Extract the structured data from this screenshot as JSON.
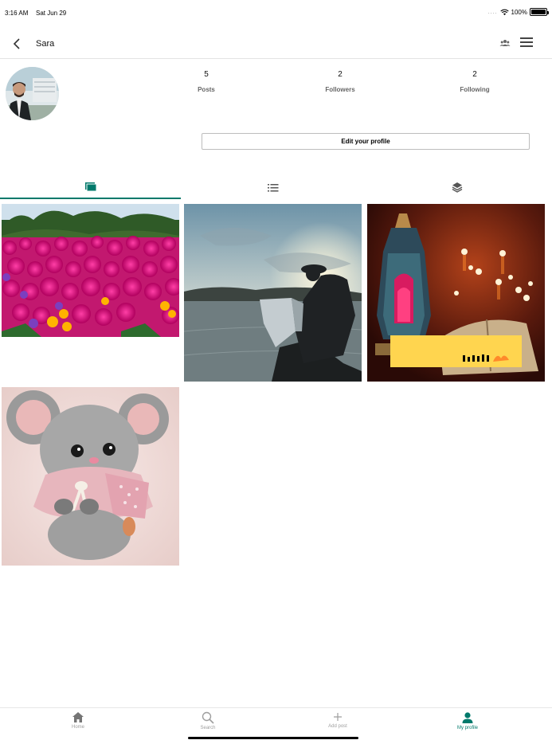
{
  "status_bar": {
    "time": "3:16 AM",
    "date": "Sat Jun 29",
    "battery": "100%"
  },
  "header": {
    "title": "Sara"
  },
  "profile": {
    "stats": [
      {
        "value": "5",
        "label": "Posts"
      },
      {
        "value": "2",
        "label": "Followers"
      },
      {
        "value": "2",
        "label": "Following"
      }
    ],
    "edit_button_label": "Edit your profile"
  },
  "tabs": [
    {
      "icon": "grid-icon",
      "active": true
    },
    {
      "icon": "list-icon",
      "active": false
    },
    {
      "icon": "layers-icon",
      "active": false
    }
  ],
  "posts": [
    {
      "subject": "pink flower field"
    },
    {
      "subject": "man reading map by lake at sunset"
    },
    {
      "subject": "lantern and open book with candles"
    },
    {
      "subject": "plush grey mouse toy"
    }
  ],
  "bottom_nav": [
    {
      "label": "Home",
      "icon": "home-icon"
    },
    {
      "label": "Search",
      "icon": "search-icon"
    },
    {
      "label": "Add post",
      "icon": "plus-icon"
    },
    {
      "label": "My profile",
      "icon": "person-icon"
    }
  ],
  "colors": {
    "accent": "#00796b"
  }
}
